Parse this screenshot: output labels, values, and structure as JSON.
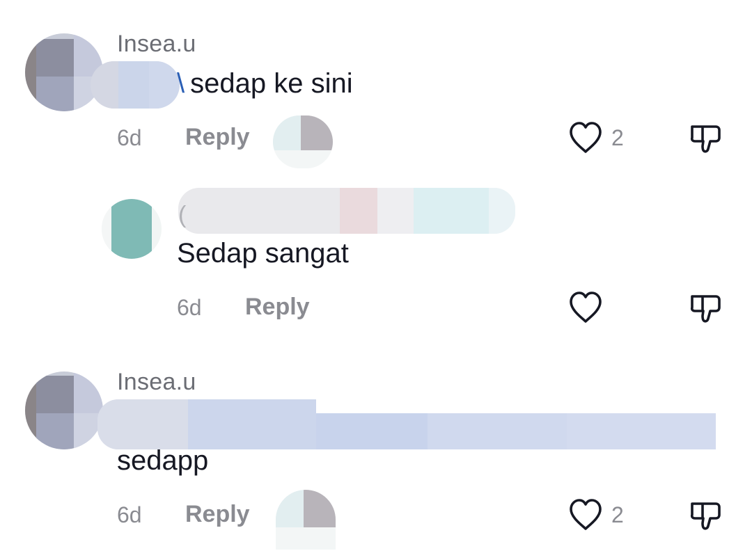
{
  "comments": [
    {
      "username": "Insea.u",
      "mention_fragment": "\\",
      "text": "sedap ke sini",
      "time": "6d",
      "reply_label": "Reply",
      "like_count": "2"
    },
    {
      "username_fragment": "(",
      "text": "Sedap sangat",
      "time": "6d",
      "reply_label": "Reply",
      "like_count": ""
    },
    {
      "username": "Insea.u",
      "text": "sedapp",
      "time": "6d",
      "reply_label": "Reply",
      "like_count": "2"
    }
  ],
  "icons": {
    "like": "heart-outline-icon",
    "dislike": "thumbs-down-outline-icon"
  },
  "colors": {
    "text_primary": "#161823",
    "text_secondary": "#8a8b91",
    "mention": "#2b5fb5"
  }
}
